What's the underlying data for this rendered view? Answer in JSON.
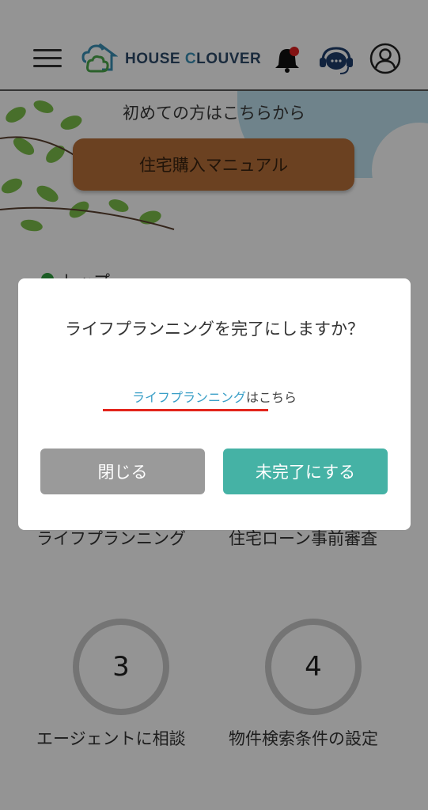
{
  "header": {
    "logo_part1": "HOUSE ",
    "logo_part2": "C",
    "logo_part3": "LOUVER"
  },
  "hero": {
    "intro_text": "初めての方はこちらから",
    "manual_button": "住宅購入マニュアル"
  },
  "section": {
    "label": "トップ"
  },
  "steps": [
    {
      "number": "3",
      "label": "エージェントに相談"
    },
    {
      "number": "4",
      "label": "物件検索条件の設定"
    }
  ],
  "steps_behind_modal": [
    {
      "label": "ライフプランニング"
    },
    {
      "label": "住宅ローン事前審査"
    }
  ],
  "modal": {
    "title": "ライフプランニングを完了にしますか？",
    "link_text": "ライフプランニング",
    "link_suffix": "はこちら",
    "close_button": "閉じる",
    "incomplete_button": "未完了にする"
  },
  "colors": {
    "accent_teal": "#45b2a5",
    "link_blue": "#3a9fc7",
    "underline_red": "#e3241b",
    "manual_brown": "#b8703a",
    "notification_red": "#e02020"
  }
}
